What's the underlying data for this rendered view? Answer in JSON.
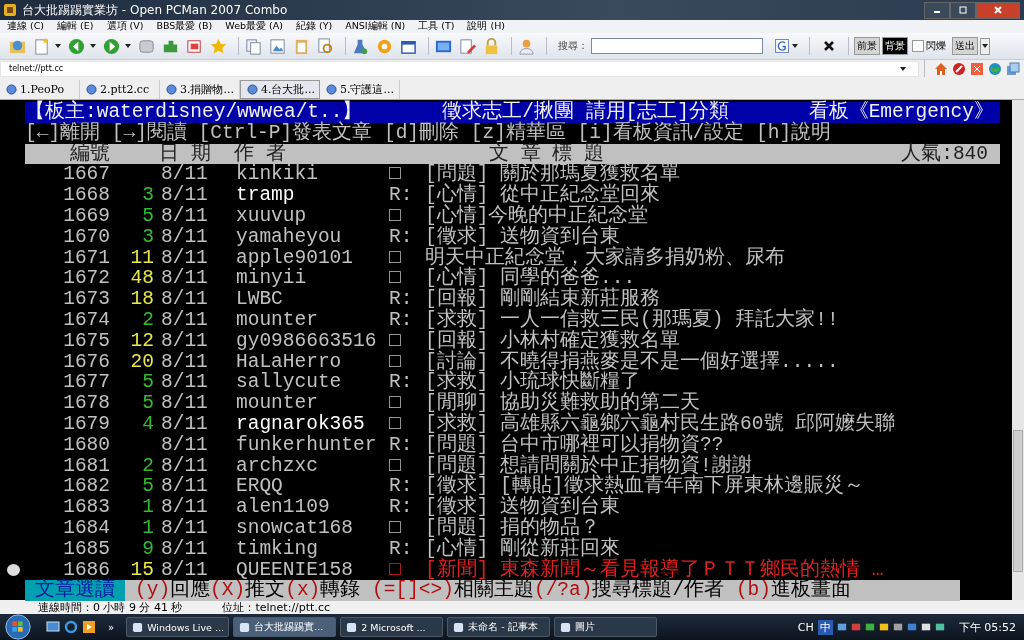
{
  "window": {
    "title": "台大批踢踢實業坊 - Open PCMan 2007 Combo"
  },
  "menu": [
    "連線 (C)",
    "編輯 (E)",
    "選項 (V)",
    "BBS最愛 (B)",
    "Web最愛 (A)",
    "紀錄 (Y)",
    "ANSI編輯 (N)",
    "工具 (T)",
    "說明 (H)"
  ],
  "search": {
    "label": "搜尋："
  },
  "color_bar": {
    "foreground": "前景",
    "background": "背景",
    "blink": {
      "label": "閃爍",
      "checked": false
    },
    "send": "送出"
  },
  "address": {
    "value": "telnet://ptt.cc"
  },
  "tabs": [
    {
      "label": "1.PeoPo",
      "selected": false
    },
    {
      "label": "2.ptt2.cc",
      "selected": false
    },
    {
      "label": "3.捐贈物...",
      "selected": false
    },
    {
      "label": "4.台大批...",
      "selected": true
    },
    {
      "label": "5.守護這...",
      "selected": false
    }
  ],
  "terminal": {
    "board_bar": {
      "moderators": "【板主:waterdisney/wwwea/t..】",
      "notice": "徵求志工/揪團 請用[志工]分類",
      "board": "看板《Emergency》"
    },
    "help_line": "[←]離開 [→]閱讀 [Ctrl-P]發表文章 [d]刪除 [z]精華區 [i]看板資訊/設定 [h]說明",
    "columns": [
      "編號",
      "日 期",
      "作  者",
      "文  章  標  題",
      "人氣:840"
    ],
    "rows": [
      {
        "number": "1667",
        "date": "8/11",
        "author": "kinkiki",
        "bright": false,
        "mark": "□",
        "title": "[問題] 關於那瑪夏獲救名單",
        "selected": false
      },
      {
        "number": "1668",
        "push": {
          "count": "3",
          "color": "#33bb33"
        },
        "date": "8/11",
        "author": "tramp",
        "bright": true,
        "mark": "R:",
        "title": "[心情] 從中正紀念堂回來",
        "selected": false
      },
      {
        "number": "1669",
        "push": {
          "count": "5",
          "color": "#33bb33"
        },
        "date": "8/11",
        "author": "xuuvup",
        "bright": false,
        "mark": "□",
        "title": "[心情]今晚的中正紀念堂",
        "selected": false
      },
      {
        "number": "1670",
        "push": {
          "count": "3",
          "color": "#33bb33"
        },
        "date": "8/11",
        "author": "yamaheyou",
        "bright": false,
        "mark": "R:",
        "title": "[徵求] 送物資到台東",
        "selected": false
      },
      {
        "number": "1671",
        "push": {
          "count": "11",
          "color": "#e8e84a"
        },
        "date": "8/11",
        "author": "apple90101",
        "bright": false,
        "mark": "□",
        "title": "明天中正紀念堂，大家請多捐奶粉、尿布",
        "selected": false
      },
      {
        "number": "1672",
        "push": {
          "count": "48",
          "color": "#e8e84a"
        },
        "date": "8/11",
        "author": "minyii",
        "bright": false,
        "mark": "□",
        "title": "[心情] 同學的爸爸...",
        "selected": false
      },
      {
        "number": "1673",
        "push": {
          "count": "18",
          "color": "#e8e84a"
        },
        "date": "8/11",
        "author": "LWBC",
        "bright": false,
        "mark": "R:",
        "title": "[回報] 剛剛結束新莊服務",
        "selected": false
      },
      {
        "number": "1674",
        "push": {
          "count": "2",
          "color": "#33bb33"
        },
        "date": "8/11",
        "author": "mounter",
        "bright": false,
        "mark": "R:",
        "title": "[求救] 一人一信救三民(那瑪夏) 拜託大家!!",
        "selected": false
      },
      {
        "number": "1675",
        "push": {
          "count": "12",
          "color": "#e8e84a"
        },
        "date": "8/11",
        "author": "gy0986663516",
        "bright": false,
        "mark": "□",
        "title": "[回報] 小林村確定獲救名單",
        "selected": false
      },
      {
        "number": "1676",
        "push": {
          "count": "20",
          "color": "#e8e84a"
        },
        "date": "8/11",
        "author": "HaLaHerro",
        "bright": false,
        "mark": "□",
        "title": "[討論] 不曉得捐燕麥是不是一個好選擇.....",
        "selected": false
      },
      {
        "number": "1677",
        "push": {
          "count": "5",
          "color": "#33bb33"
        },
        "date": "8/11",
        "author": "sallycute",
        "bright": false,
        "mark": "R:",
        "title": "[求救] 小琉球快斷糧了",
        "selected": false
      },
      {
        "number": "1678",
        "push": {
          "count": "5",
          "color": "#33bb33"
        },
        "date": "8/11",
        "author": "mounter",
        "bright": false,
        "mark": "□",
        "title": "[閒聊] 協助災難救助的第二天",
        "selected": false
      },
      {
        "number": "1679",
        "push": {
          "count": "4",
          "color": "#33bb33"
        },
        "date": "8/11",
        "author": "ragnarok365",
        "bright": true,
        "mark": "□",
        "title": "[求救] 高雄縣六龜鄉六龜村民生路60號 邱阿嬤失聯",
        "selected": false
      },
      {
        "number": "1680",
        "date": "8/11",
        "author": "funkerhunter",
        "bright": false,
        "mark": "R:",
        "title": "[問題] 台中市哪裡可以捐物資??",
        "selected": false
      },
      {
        "number": "1681",
        "push": {
          "count": "2",
          "color": "#33bb33"
        },
        "date": "8/11",
        "author": "archzxc",
        "bright": false,
        "mark": "□",
        "title": "[問題] 想請問關於中正捐物資!謝謝",
        "selected": false
      },
      {
        "number": "1682",
        "push": {
          "count": "5",
          "color": "#33bb33"
        },
        "date": "8/11",
        "author": "ERQQ",
        "bright": false,
        "mark": "R:",
        "title": "[徵求] [轉貼]徵求熱血青年南下屏東林邊賑災～",
        "selected": false
      },
      {
        "number": "1683",
        "push": {
          "count": "1",
          "color": "#33bb33"
        },
        "date": "8/11",
        "author": "alen1109",
        "bright": false,
        "mark": "R:",
        "title": "[徵求] 送物資到台東",
        "selected": false
      },
      {
        "number": "1684",
        "push": {
          "count": "1",
          "color": "#33bb33"
        },
        "date": "8/11",
        "author": "snowcat168",
        "bright": false,
        "mark": "□",
        "title": "[問題] 捐的物品？",
        "selected": false
      },
      {
        "number": "1685",
        "push": {
          "count": "9",
          "color": "#33bb33"
        },
        "date": "8/11",
        "author": "timking",
        "bright": false,
        "mark": "R:",
        "title": "[心情] 剛從新莊回來",
        "selected": false
      },
      {
        "number": "1686",
        "push": {
          "count": "15",
          "color": "#e8e84a"
        },
        "date": "8/11",
        "author": "QUEENIE158",
        "bright": false,
        "mark": "□",
        "title": "[新聞] 東森新聞～看見報導了ＰＴＴ鄉民的熱情 …",
        "color": "#e02020",
        "selected": true
      }
    ],
    "footer": {
      "mode": "文章選讀",
      "commands": [
        {
          "key": "(y)",
          "label": "回應"
        },
        {
          "key": "(X)",
          "label": "推文"
        },
        {
          "key": "(x)",
          "label": "轉錄 "
        },
        {
          "key": "(=[]<>)",
          "label": "相關主題"
        },
        {
          "key": "(/?a)",
          "label": "搜尋標題/作者 "
        },
        {
          "key": "(b)",
          "label": "進板畫面"
        }
      ]
    }
  },
  "status_bar": {
    "connected": "連線時間：0 小時 9 分 41 秒",
    "address": "位址：telnet://ptt.cc"
  },
  "taskbar": {
    "overflow": "»",
    "tasks": [
      {
        "label": "Windows Live ...",
        "selected": false
      },
      {
        "label": "台大批踢踢實...",
        "selected": true
      },
      {
        "label": "2 Microsoft ...",
        "selected": false
      },
      {
        "label": "未命名 - 記事本",
        "selected": false
      },
      {
        "label": "圖片",
        "selected": false
      }
    ],
    "language": "CH",
    "ime": "中",
    "clock": "下午 05:52"
  }
}
